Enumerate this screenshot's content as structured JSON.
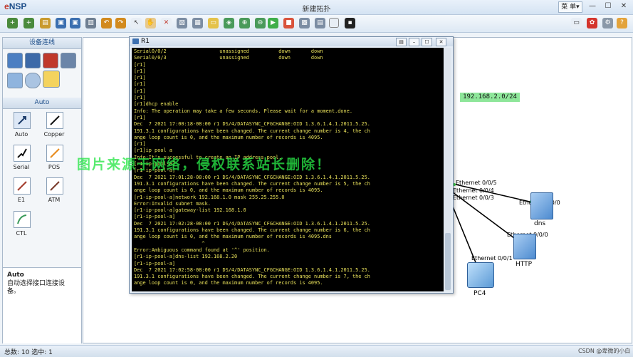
{
  "app": {
    "logo_e": "e",
    "logo_rest": "NSP",
    "window_title": "新建拓扑",
    "menu_label": "菜 单▾"
  },
  "toolbar_icons": [
    "new-file",
    "new-topo",
    "open",
    "save",
    "save-as",
    "print",
    "undo",
    "redo",
    "select",
    "hand",
    "delete",
    "clear",
    "text",
    "note",
    "rect",
    "zoom-in",
    "zoom-out",
    "fit",
    "start",
    "stop",
    "capture",
    "settings",
    "palette",
    "grid",
    "topo",
    "chat",
    "huawei",
    "gear",
    "help"
  ],
  "left_panel": {
    "section1_title": "设备连线",
    "section2_title": "Auto",
    "cables": [
      {
        "label": "Auto"
      },
      {
        "label": "Copper"
      },
      {
        "label": "Serial"
      },
      {
        "label": "POS"
      },
      {
        "label": "E1"
      },
      {
        "label": "ATM"
      },
      {
        "label": "CTL"
      }
    ],
    "desc_title": "Auto",
    "desc_text": "自动选择接口连接设备。"
  },
  "canvas": {
    "ip_label": "192.168.2.0/24",
    "port_labels": [
      "Ethernet 0/0/5",
      "Ethernet 0/0/4",
      "Ethernet 0/0/3",
      "Ethernet 0/0/0",
      "Ethernet 0/0/0",
      "Ethernet 0/0/1"
    ],
    "nodes": [
      "dns",
      "HTTP",
      "PC4"
    ]
  },
  "terminal": {
    "title": "R1",
    "lines": [
      "Serial0/0/2                  unassigned          down       down",
      "Serial0/0/3                  unassigned          down       down",
      "[r1]",
      "[r1]",
      "[r1]",
      "[r1]",
      "[r1]",
      "[r1]",
      "[r1]dhcp enable",
      "Info: The operation may take a few seconds. Please wait for a moment.done.",
      "[r1]",
      "Dec  7 2021 17:00:18-08:00 r1 DS/4/DATASYNC_CFGCHANGE:OID 1.3.6.1.4.1.2011.5.25.",
      "191.3.1 configurations have been changed. The current change number is 4, the ch",
      "ange loop count is 0, and the maximum number of records is 4095.",
      "[r1]",
      "[r1]ip pool a",
      "Info:It's successful to create an IP address pool.",
      "[r1-ip-pool-a]",
      "[r1-ip-pool-a]",
      "Dec  7 2021 17:01:28-08:00 r1 DS/4/DATASYNC_CFGCHANGE:OID 1.3.6.1.4.1.2011.5.25.",
      "191.3.1 configurations have been changed. The current change number is 5, the ch",
      "ange loop count is 0, and the maximum number of records is 4095.",
      "[r1-ip-pool-a]network 192.168.1.0 mask 255.25.255.0",
      "Error:Invalid subnet mask.",
      "[r1-ip-pool-a]gateway-list 192.168.1.0",
      "[r1-ip-pool-a]",
      "Dec  7 2021 17:02:28-08:00 r1 DS/4/DATASYNC_CFGCHANGE:OID 1.3.6.1.4.1.2011.5.25.",
      "191.3.1 configurations have been changed. The current change number is 6, the ch",
      "ange loop count is 0, and the maximum number of records is 4095.dns",
      "                       ^",
      "Error:Ambiguous command found at '^' position.",
      "[r1-ip-pool-a]dns-list 192.168.2.20",
      "[r1-ip-pool-a]",
      "Dec  7 2021 17:02:58-08:00 r1 DS/4/DATASYNC_CFGCHANGE:OID 1.3.6.1.4.1.2011.5.25.",
      "191.3.1 configurations have been changed. The current change number is 7, the ch",
      "ange loop count is 0, and the maximum number of records is 4095."
    ]
  },
  "watermark": "图片来源于网络，侵权联系站长删除！",
  "statusbar": {
    "text": "总数: 10 选中: 1",
    "csdn": "CSDN @卑微的小白"
  },
  "colors": {
    "terminal_text": "#e8e05a",
    "ip_bg": "#8ee69a",
    "watermark": "#28e646"
  }
}
